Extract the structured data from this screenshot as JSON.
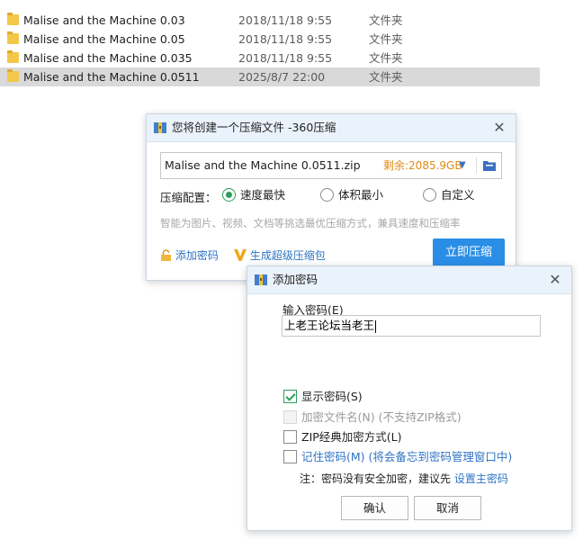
{
  "files": [
    {
      "name": "Malise and the Machine 0.03",
      "date": "2018/11/18 9:55",
      "type": "文件夹",
      "selected": false
    },
    {
      "name": "Malise and the Machine 0.05",
      "date": "2018/11/18 9:55",
      "type": "文件夹",
      "selected": false
    },
    {
      "name": "Malise and the Machine 0.035",
      "date": "2018/11/18 9:55",
      "type": "文件夹",
      "selected": false
    },
    {
      "name": "Malise and the Machine 0.0511",
      "date": "2025/8/7 22:00",
      "type": "文件夹",
      "selected": true
    }
  ],
  "compress_dialog": {
    "title": "您将创建一个压缩文件 -360压缩",
    "filename": "Malise and the Machine 0.0511.zip",
    "space_left": "剩余:2085.9GB",
    "config_label": "压缩配置：",
    "options": [
      "速度最快",
      "体积最小",
      "自定义"
    ],
    "selected_option": "速度最快",
    "hint": "智能为图片、视频、文档等挑选最优压缩方式，兼具速度和压缩率",
    "add_password_link": "添加密码",
    "super_zip_link": "生成超级压缩包",
    "compress_button": "立即压缩",
    "accent_color": "#2b8ee6"
  },
  "password_dialog": {
    "title": "添加密码",
    "input_label": "输入密码(E)",
    "password_value": "上老王论坛当老王",
    "show_password": {
      "label": "显示密码(S)",
      "checked": true
    },
    "encrypt_filenames": {
      "label": "加密文件名(N) (不支持ZIP格式)",
      "checked": false,
      "disabled": true
    },
    "zip_classic": {
      "label": "ZIP经典加密方式(L)",
      "checked": false
    },
    "remember_password": {
      "label": "记住密码(M) (将会备忘到密码管理窗口中)",
      "checked": false
    },
    "note_prefix": "注：密码没有安全加密，建议先",
    "note_link": "设置主密码",
    "ok_button": "确认",
    "cancel_button": "取消"
  }
}
